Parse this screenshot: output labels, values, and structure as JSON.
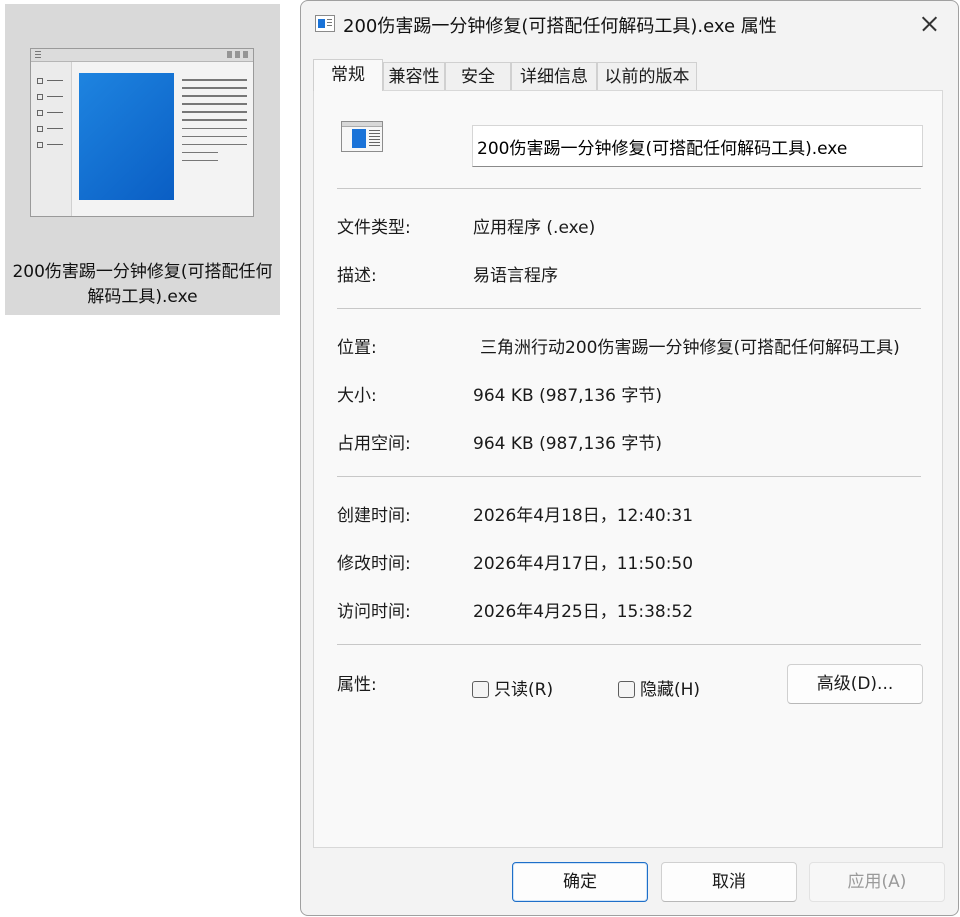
{
  "desktop_file": {
    "name": "200伤害踢一分钟修复(可搭配任何解码工具).exe",
    "icon": "window-app-icon"
  },
  "dialog": {
    "title": "200伤害踢一分钟修复(可搭配任何解码工具).exe 属性",
    "tabs": [
      "常规",
      "兼容性",
      "安全",
      "详细信息",
      "以前的版本"
    ],
    "active_tab": "常规",
    "file_name_value": "200伤害踢一分钟修复(可搭配任何解码工具).exe",
    "fields": {
      "type_label": "文件类型:",
      "type_value": "应用程序 (.exe)",
      "desc_label": "描述:",
      "desc_value": "易语言程序",
      "location_label": "位置:",
      "location_value": "三角洲行动200伤害踢一分钟修复(可搭配任何解码工具)",
      "size_label": "大小:",
      "size_value": "964 KB (987,136 字节)",
      "disk_label": "占用空间:",
      "disk_value": "964 KB (987,136 字节)",
      "created_label": "创建时间:",
      "created_value": "2026年4月18日，12:40:31",
      "modified_label": "修改时间:",
      "modified_value": "2026年4月17日，11:50:50",
      "accessed_label": "访问时间:",
      "accessed_value": "2026年4月25日，15:38:52",
      "attrs_label": "属性:"
    },
    "attributes": {
      "readonly_label": "只读(R)",
      "readonly_checked": false,
      "hidden_label": "隐藏(H)",
      "hidden_checked": false,
      "advanced_label": "高级(D)..."
    },
    "buttons": {
      "ok": "确定",
      "cancel": "取消",
      "apply": "应用(A)"
    }
  }
}
